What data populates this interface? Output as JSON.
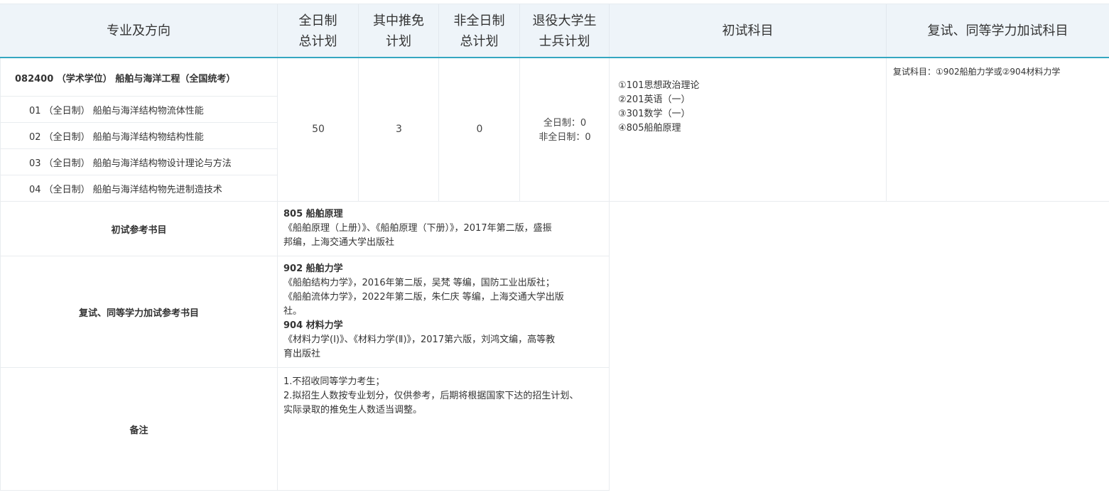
{
  "header": {
    "major": "专业及方向",
    "total_plan": [
      "全日制",
      "总计划"
    ],
    "exempt_plan": [
      "其中推免",
      "计划"
    ],
    "part_time_plan": [
      "非全日制",
      "总计划"
    ],
    "veteran_plan": [
      "退役大学生",
      "士兵计划"
    ],
    "initial_subjects": "初试科目",
    "retest_subjects": "复试、同等学力加试科目"
  },
  "program": {
    "title": "082400 （学术学位） 船舶与海洋工程（全国统考）",
    "directions": [
      "01 （全日制） 船舶与海洋结构物流体性能",
      "02 （全日制） 船舶与海洋结构物结构性能",
      "03 （全日制） 船舶与海洋结构物设计理论与方法",
      "04 （全日制） 船舶与海洋结构物先进制造技术"
    ],
    "total_plan": "50",
    "exempt_plan": "3",
    "part_time_plan": "0",
    "veteran_full": "全日制：0",
    "veteran_part": "非全日制：0",
    "initial_subjects": [
      "①101思想政治理论",
      "②201英语（一）",
      "③301数学（一）",
      "④805船舶原理"
    ],
    "retest_subjects": "复试科目：①902船舶力学或②904材料力学"
  },
  "initial_books": {
    "label": "初试参考书目",
    "code": "805 船舶原理",
    "line1": "《船舶原理（上册）》、《船舶原理（下册）》，2017年第二版，盛振",
    "line2": "邦编，上海交通大学出版社"
  },
  "retest_books": {
    "label": "复试、同等学力加试参考书目",
    "code1": "902 船舶力学",
    "line1": "《船舶结构力学》，2016年第二版，吴梵 等编，国防工业出版社；",
    "line2": "《船舶流体力学》，2022年第二版，朱仁庆 等编，上海交通大学出版",
    "line3": "社。",
    "code2": "904 材料力学",
    "line4": "《材料力学(Ⅰ)》、《材料力学(Ⅱ)》，2017第六版，刘鸿文编，高等教",
    "line5": "育出版社"
  },
  "notes": {
    "label": "备注",
    "line1": "1.不招收同等学力考生；",
    "line2": "2.拟招生人数按专业划分，仅供参考，后期将根据国家下达的招生计划、",
    "line3": "实际录取的推免生人数适当调整。"
  }
}
